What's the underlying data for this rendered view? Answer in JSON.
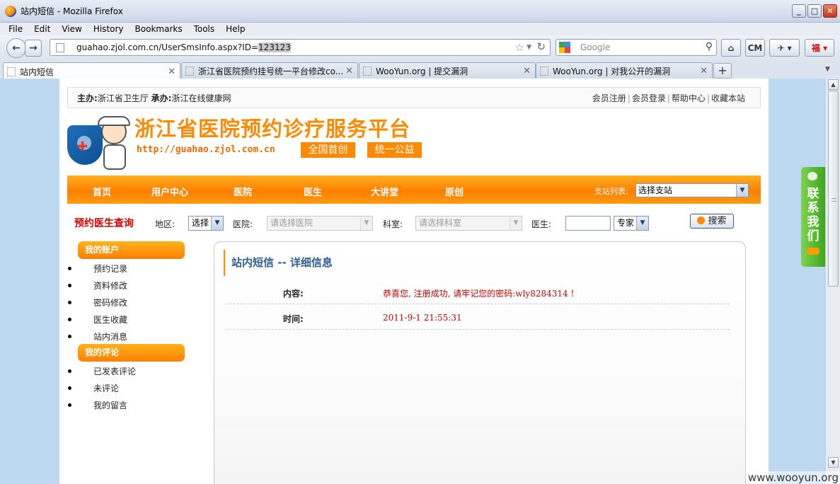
{
  "window": {
    "title": "站内短信 - Mozilla Firefox"
  },
  "menu": [
    "File",
    "Edit",
    "View",
    "History",
    "Bookmarks",
    "Tools",
    "Help"
  ],
  "address": {
    "url_prefix": "guahao.zjol.com.cn/UserSmsInfo.aspx?ID=",
    "url_selected": "123123"
  },
  "search": {
    "placeholder": "Google"
  },
  "toolbar": {
    "cm_label": "CM",
    "fu_label": "福"
  },
  "tabs": [
    {
      "label": "站内短信",
      "active": true
    },
    {
      "label": "浙江省医院预约挂号统一平台修改co...",
      "active": false
    },
    {
      "label": "WooYun.org | 提交漏洞",
      "active": false
    },
    {
      "label": "WooYun.org | 对我公开的漏洞",
      "active": false
    }
  ],
  "site": {
    "host_label": "主办:",
    "host_value": "浙江省卫生厅",
    "organizer_label": "承办:",
    "organizer_value": "浙江在线健康网",
    "top_links": [
      "会员注册",
      "会员登录",
      "帮助中心",
      "收藏本站"
    ],
    "title": "浙江省医院预约诊疗服务平台",
    "url": "http://guahao.zjol.com.cn",
    "badges": [
      "全国首创",
      "统一公益"
    ],
    "nav": [
      "首页",
      "用户中心",
      "医院",
      "医生",
      "大讲堂",
      "原创"
    ],
    "station_label": "支站列表:",
    "station_value": "选择支站"
  },
  "search_row": {
    "title": "预约医生查询",
    "region_label": "地区:",
    "region_value": "选择",
    "hospital_label": "医院:",
    "hospital_placeholder": "请选择医院",
    "dept_label": "科室:",
    "dept_placeholder": "请选择科室",
    "doctor_label": "医生:",
    "doctor_value": "",
    "expert_value": "专家",
    "search_button": "搜索"
  },
  "sidebar": {
    "account_title": "我的账户",
    "account_items": [
      "预约记录",
      "资料修改",
      "密码修改",
      "医生收藏",
      "站内消息"
    ],
    "comment_title": "我的评论",
    "comment_items": [
      "已发表评论",
      "未评论",
      "我的留言"
    ]
  },
  "detail": {
    "title": "站内短信 -- 详细信息",
    "content_label": "内容:",
    "content_value": "恭喜您, 注册成功, 请牢记您的密码:wly8284314 !",
    "time_label": "时间:",
    "time_value": "2011-9-1 21:55:31"
  },
  "contact": {
    "label": "联系我们"
  },
  "watermark": "www.wooyun.org"
}
